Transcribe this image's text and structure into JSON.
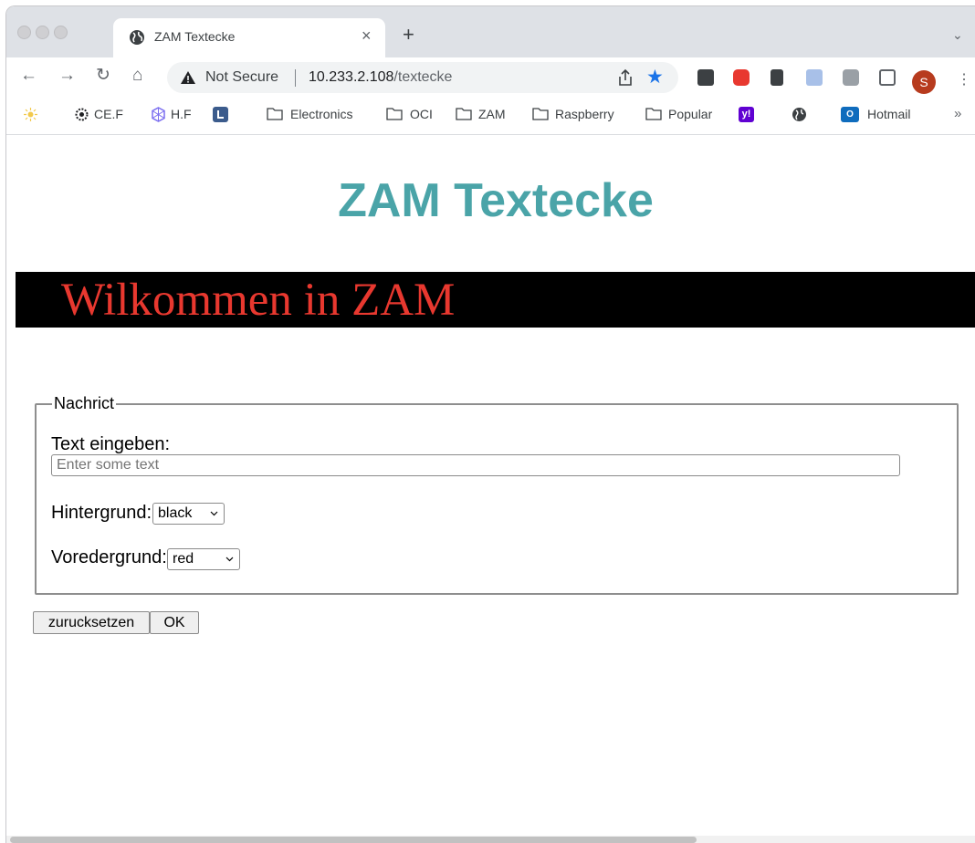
{
  "browser": {
    "tab": {
      "title": "ZAM Textecke",
      "close": "×"
    },
    "new_tab": "+",
    "tab_menu": "⌄",
    "nav": {
      "back": "←",
      "forward": "→",
      "reload": "↻",
      "home": "⌂"
    },
    "omnibox": {
      "security_label": "Not Secure",
      "url_host": "10.233.2.108",
      "url_path": "/textecke"
    },
    "profile_initial": "S",
    "menu": "⋮",
    "bookmarks": [
      {
        "label": "CE.F"
      },
      {
        "label": "H.F"
      },
      {
        "label": "Electronics"
      },
      {
        "label": "OCI"
      },
      {
        "label": "ZAM"
      },
      {
        "label": "Raspberry"
      },
      {
        "label": "Popular"
      },
      {
        "label": "Hotmail"
      }
    ],
    "bookmarks_more": "»"
  },
  "page": {
    "title": "ZAM Textecke",
    "banner_text": "Wilkommen in ZAM",
    "banner_background": "#000000",
    "banner_foreground": "#e8382f",
    "title_color": "#4aa4a8",
    "form": {
      "legend": "Nachrict",
      "text_label": "Text eingeben:",
      "text_placeholder": "Enter some text",
      "text_value": "",
      "background_label": "Hintergrund:",
      "background_value": "black",
      "foreground_label": "Voredergrund:",
      "foreground_value": "red",
      "reset_label": "zurucksetzen",
      "ok_label": "OK"
    }
  }
}
